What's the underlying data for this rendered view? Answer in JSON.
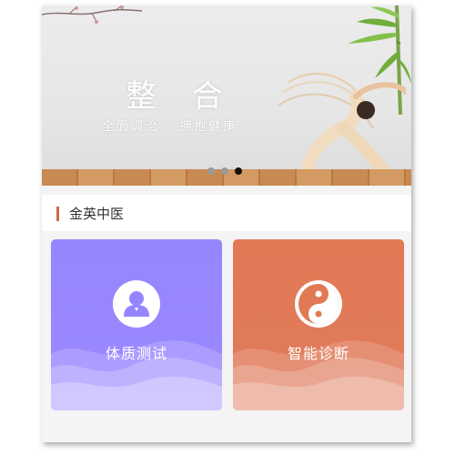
{
  "banner": {
    "title": "整 合",
    "subtitle": "全面调治   拥抱健康",
    "slides_count": 3,
    "active_slide": 3
  },
  "section": {
    "title": "金英中医"
  },
  "cards": [
    {
      "label": "体质测试",
      "icon": "user-icon",
      "color": "#9585ff"
    },
    {
      "label": "智能诊断",
      "icon": "yin-yang-icon",
      "color": "#e27955"
    }
  ]
}
